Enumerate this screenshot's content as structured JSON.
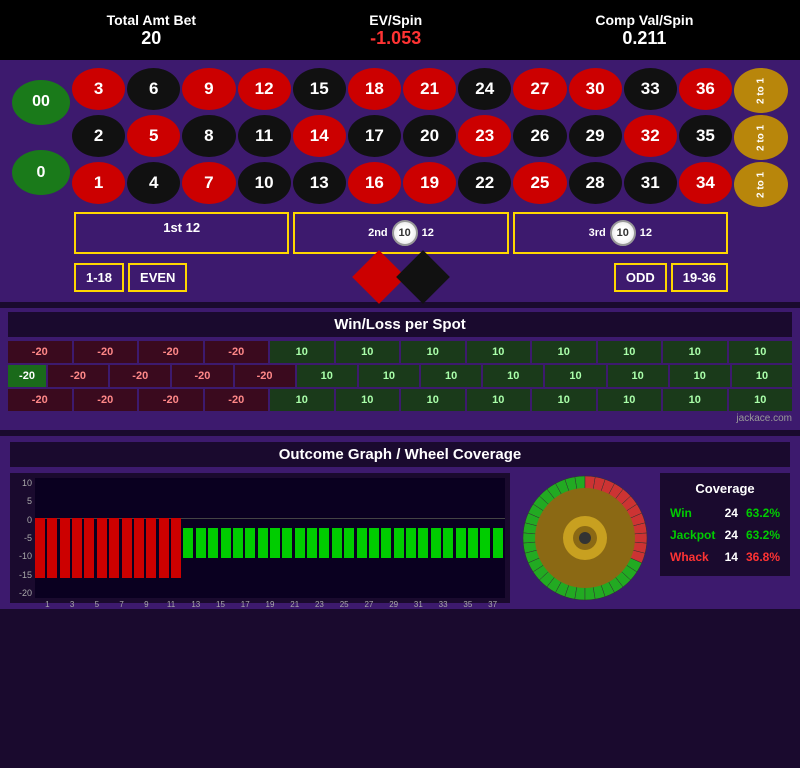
{
  "stats": {
    "total_amt_bet_label": "Total Amt Bet",
    "total_amt_bet_value": "20",
    "ev_spin_label": "EV/Spin",
    "ev_spin_value": "-1.053",
    "comp_val_spin_label": "Comp Val/Spin",
    "comp_val_spin_value": "0.211"
  },
  "roulette": {
    "zeros": [
      "00",
      "0"
    ],
    "numbers": [
      {
        "n": "3",
        "c": "red"
      },
      {
        "n": "6",
        "c": "black"
      },
      {
        "n": "9",
        "c": "red"
      },
      {
        "n": "12",
        "c": "red"
      },
      {
        "n": "15",
        "c": "black"
      },
      {
        "n": "18",
        "c": "red"
      },
      {
        "n": "21",
        "c": "red"
      },
      {
        "n": "24",
        "c": "black"
      },
      {
        "n": "27",
        "c": "red"
      },
      {
        "n": "30",
        "c": "red"
      },
      {
        "n": "33",
        "c": "black"
      },
      {
        "n": "36",
        "c": "red"
      },
      {
        "n": "2",
        "c": "black"
      },
      {
        "n": "5",
        "c": "red"
      },
      {
        "n": "8",
        "c": "black"
      },
      {
        "n": "11",
        "c": "black"
      },
      {
        "n": "14",
        "c": "red"
      },
      {
        "n": "17",
        "c": "black"
      },
      {
        "n": "20",
        "c": "black"
      },
      {
        "n": "23",
        "c": "red"
      },
      {
        "n": "26",
        "c": "black"
      },
      {
        "n": "29",
        "c": "black"
      },
      {
        "n": "32",
        "c": "red"
      },
      {
        "n": "35",
        "c": "black"
      },
      {
        "n": "1",
        "c": "red"
      },
      {
        "n": "4",
        "c": "black"
      },
      {
        "n": "7",
        "c": "red"
      },
      {
        "n": "10",
        "c": "black"
      },
      {
        "n": "13",
        "c": "black"
      },
      {
        "n": "16",
        "c": "red"
      },
      {
        "n": "19",
        "c": "red"
      },
      {
        "n": "22",
        "c": "black"
      },
      {
        "n": "25",
        "c": "red"
      },
      {
        "n": "28",
        "c": "black"
      },
      {
        "n": "31",
        "c": "black"
      },
      {
        "n": "34",
        "c": "red"
      }
    ],
    "side_bets": [
      "2 to 1",
      "2 to 1",
      "2 to 1"
    ],
    "dozens": [
      "1st 12",
      "2nd 12",
      "3rd 12"
    ],
    "dozen_chip_value": "10",
    "bottom_bets": [
      "1-18",
      "EVEN",
      "ODD",
      "19-36"
    ]
  },
  "win_loss": {
    "title": "Win/Loss per Spot",
    "row1": [
      "-20",
      "-20",
      "-20",
      "-20",
      "10",
      "10",
      "10",
      "10",
      "10",
      "10",
      "10",
      "10"
    ],
    "row2": [
      "-20",
      "-20",
      "-20",
      "-20",
      "10",
      "10",
      "10",
      "10",
      "10",
      "10",
      "10",
      "10"
    ],
    "row3": [
      "-20",
      "-20",
      "-20",
      "-20",
      "10",
      "10",
      "10",
      "10",
      "10",
      "10",
      "10",
      "10"
    ],
    "left_cell": "-20"
  },
  "outcome": {
    "title": "Outcome Graph / Wheel Coverage",
    "y_labels": [
      "10",
      "5",
      "0",
      "-5",
      "-10",
      "-15",
      "-20"
    ],
    "x_labels": [
      "1",
      "3",
      "5",
      "7",
      "9",
      "11",
      "13",
      "15",
      "17",
      "19",
      "21",
      "23",
      "25",
      "27",
      "29",
      "31",
      "33",
      "35",
      "37"
    ],
    "bars": [
      {
        "v": -20,
        "t": "neg"
      },
      {
        "v": -20,
        "t": "neg"
      },
      {
        "v": -20,
        "t": "neg"
      },
      {
        "v": -20,
        "t": "neg"
      },
      {
        "v": -20,
        "t": "neg"
      },
      {
        "v": -20,
        "t": "neg"
      },
      {
        "v": -20,
        "t": "neg"
      },
      {
        "v": -20,
        "t": "neg"
      },
      {
        "v": -20,
        "t": "neg"
      },
      {
        "v": -20,
        "t": "neg"
      },
      {
        "v": -20,
        "t": "neg"
      },
      {
        "v": -20,
        "t": "neg"
      },
      {
        "v": 10,
        "t": "pos"
      },
      {
        "v": 10,
        "t": "pos"
      },
      {
        "v": 10,
        "t": "pos"
      },
      {
        "v": 10,
        "t": "pos"
      },
      {
        "v": 10,
        "t": "pos"
      },
      {
        "v": 10,
        "t": "pos"
      },
      {
        "v": 10,
        "t": "pos"
      },
      {
        "v": 10,
        "t": "pos"
      },
      {
        "v": 10,
        "t": "pos"
      },
      {
        "v": 10,
        "t": "pos"
      },
      {
        "v": 10,
        "t": "pos"
      },
      {
        "v": 10,
        "t": "pos"
      },
      {
        "v": 10,
        "t": "pos"
      },
      {
        "v": 10,
        "t": "pos"
      },
      {
        "v": 10,
        "t": "pos"
      },
      {
        "v": 10,
        "t": "pos"
      },
      {
        "v": 10,
        "t": "pos"
      },
      {
        "v": 10,
        "t": "pos"
      },
      {
        "v": 10,
        "t": "pos"
      },
      {
        "v": 10,
        "t": "pos"
      },
      {
        "v": 10,
        "t": "pos"
      },
      {
        "v": 10,
        "t": "pos"
      },
      {
        "v": 10,
        "t": "pos"
      },
      {
        "v": 10,
        "t": "pos"
      },
      {
        "v": 10,
        "t": "pos"
      },
      {
        "v": 10,
        "t": "pos"
      }
    ],
    "coverage": {
      "title": "Coverage",
      "win_label": "Win",
      "win_count": "24",
      "win_pct": "63.2%",
      "jackpot_label": "Jackpot",
      "jackpot_count": "24",
      "jackpot_pct": "63.2%",
      "whack_label": "Whack",
      "whack_count": "14",
      "whack_pct": "36.8%"
    },
    "credit": "jackace.com"
  }
}
